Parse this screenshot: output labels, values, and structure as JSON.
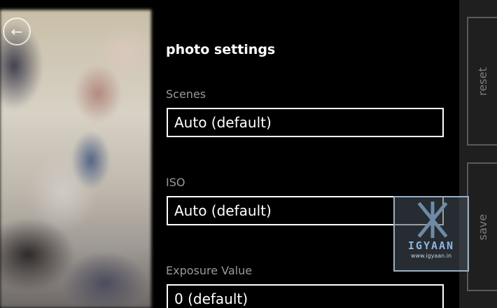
{
  "viewfinder": {
    "back_icon": "back-arrow-icon"
  },
  "settings": {
    "title": "photo settings",
    "fields": [
      {
        "label": "Scenes",
        "value": "Auto (default)"
      },
      {
        "label": "ISO",
        "value": "Auto (default)"
      },
      {
        "label": "Exposure Value",
        "value": "0 (default)"
      }
    ]
  },
  "appbar": {
    "reset_label": "reset",
    "save_label": "save"
  },
  "watermark": {
    "logo_text": "IGYAAN",
    "url": "www.igyaan.in"
  },
  "colors": {
    "background": "#000000",
    "label_gray": "#9a9a9a",
    "appbar_bg": "#1f1f1f",
    "watermark_blue": "#8fb6de"
  }
}
